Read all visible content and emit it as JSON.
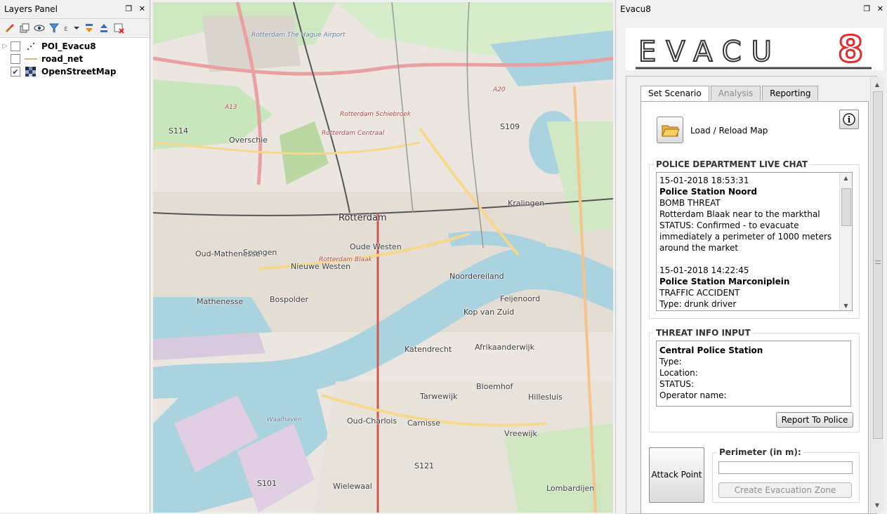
{
  "layers_panel": {
    "title": "Layers Panel",
    "float_icon": "float-icon",
    "close_icon": "close-icon",
    "toolbar_icons": [
      "paint-brush-icon",
      "add-group-icon",
      "eye-icon",
      "filter-icon",
      "expression-filter-icon",
      "expand-all-icon",
      "collapse-all-icon",
      "remove-layer-icon"
    ],
    "layers": [
      {
        "name": "POI_Evacu8",
        "checked": false,
        "icon": "point-layer-icon",
        "expandable": true
      },
      {
        "name": "road_net",
        "checked": false,
        "icon": "line-layer-icon",
        "expandable": false
      },
      {
        "name": "OpenStreetMap",
        "checked": true,
        "icon": "raster-layer-icon",
        "expandable": false
      }
    ]
  },
  "map": {
    "labels": [
      {
        "text": "Rotterdam",
        "cls": "big"
      },
      {
        "text": "Overschie",
        "cls": ""
      },
      {
        "text": "Kralingen",
        "cls": ""
      },
      {
        "text": "Oude Westen",
        "cls": ""
      },
      {
        "text": "Spangen",
        "cls": ""
      },
      {
        "text": "Oud-Mathenesse",
        "cls": ""
      },
      {
        "text": "Nieuwe Westen",
        "cls": ""
      },
      {
        "text": "Bospolder",
        "cls": ""
      },
      {
        "text": "Mathenesse",
        "cls": ""
      },
      {
        "text": "Noordereiland",
        "cls": ""
      },
      {
        "text": "Feijenoord",
        "cls": ""
      },
      {
        "text": "Kop van Zuid",
        "cls": ""
      },
      {
        "text": "Katendrecht",
        "cls": ""
      },
      {
        "text": "Afrikaanderwijk",
        "cls": ""
      },
      {
        "text": "Bloemhof",
        "cls": ""
      },
      {
        "text": "Tarwewijk",
        "cls": ""
      },
      {
        "text": "Hillesluis",
        "cls": ""
      },
      {
        "text": "Oud-Charlois",
        "cls": ""
      },
      {
        "text": "Carnisse",
        "cls": ""
      },
      {
        "text": "Vreewijk",
        "cls": ""
      },
      {
        "text": "Waalhaven",
        "cls": "blue"
      },
      {
        "text": "Wielewaal",
        "cls": ""
      },
      {
        "text": "Lombardijen",
        "cls": ""
      },
      {
        "text": "Rotterdam The Hague Airport",
        "cls": "blue"
      },
      {
        "text": "Rotterdam Schiebroek",
        "cls": "red"
      },
      {
        "text": "Rotterdam Centraal",
        "cls": "red"
      },
      {
        "text": "Rotterdam Blaak",
        "cls": "red"
      },
      {
        "text": "A13",
        "cls": "red"
      },
      {
        "text": "A20",
        "cls": "red"
      },
      {
        "text": "S114",
        "cls": ""
      },
      {
        "text": "S109",
        "cls": ""
      },
      {
        "text": "S101",
        "cls": ""
      },
      {
        "text": "S121",
        "cls": ""
      }
    ]
  },
  "evacu8": {
    "title": "Evacu8",
    "logo_text": "EVACU8",
    "tabs": [
      "Set Scenario",
      "Analysis",
      "Reporting"
    ],
    "load_map_label": "Load / Reload Map",
    "info_icon": "info-icon",
    "chat_title": "POLICE DEPARTMENT LIVE CHAT",
    "chat_lines": [
      {
        "text": "15-01-2018 18:53:31",
        "bold": false
      },
      {
        "text": "Police Station Noord",
        "bold": true
      },
      {
        "text": "BOMB THREAT",
        "bold": false
      },
      {
        "text": "Rotterdam Blaak near to the markthal",
        "bold": false
      },
      {
        "text": "STATUS: Confirmed - to evacuate",
        "bold": false
      },
      {
        "text": "immediately a perimeter of 1000 meters",
        "bold": false
      },
      {
        "text": "around the market",
        "bold": false
      },
      {
        "text": "",
        "bold": false
      },
      {
        "text": "15-01-2018 14:22:45",
        "bold": false
      },
      {
        "text": "Police Station Marconiplein",
        "bold": true
      },
      {
        "text": "TRAFFIC ACCIDENT",
        "bold": false
      },
      {
        "text": "Type: drunk driver",
        "bold": false
      }
    ],
    "threat_title": "THREAT INFO INPUT",
    "threat_station": "Central Police Station",
    "threat_fields": [
      "Type:",
      "Location:",
      "STATUS:",
      "Operator name:"
    ],
    "report_button": "Report To Police",
    "attack_button": "Attack Point",
    "perimeter_label": "Perimeter (in m):",
    "perimeter_value": "",
    "create_zone_button": "Create Evacuation Zone"
  }
}
